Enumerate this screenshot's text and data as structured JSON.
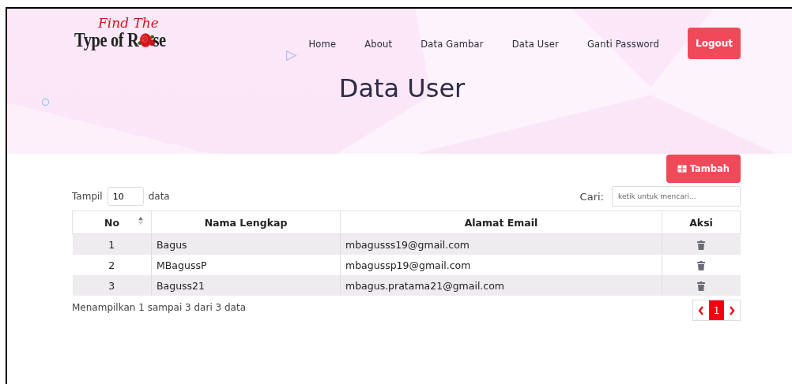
{
  "nav": {
    "logo": {
      "script": "Find The",
      "main_left": "Type of R",
      "main_right": "se"
    },
    "links": [
      "Home",
      "About",
      "Data Gambar",
      "Data User",
      "Ganti Password"
    ],
    "logout": "Logout"
  },
  "page_title": "Data User",
  "add_button": "Tambah",
  "length": {
    "label_before": "Tampil",
    "value": "10",
    "label_after": "data"
  },
  "search": {
    "label": "Cari:",
    "placeholder": "ketik untuk mencari..."
  },
  "table": {
    "columns": [
      {
        "label": "No",
        "kind": "text",
        "sorted": true
      },
      {
        "label": "Nama Lengkap",
        "kind": "text",
        "sorted": false
      },
      {
        "label": "Alamat Email",
        "kind": "text",
        "sorted": false
      },
      {
        "label": "Aksi",
        "kind": "action",
        "sorted": false
      }
    ],
    "rows": [
      {
        "cells": [
          "1",
          "Bagus",
          "mbagusss19@gmail.com"
        ]
      },
      {
        "cells": [
          "2",
          "MBagussP",
          "mbagussp19@gmail.com"
        ]
      },
      {
        "cells": [
          "3",
          "Baguss21",
          "mbagus.pratama21@gmail.com"
        ]
      }
    ]
  },
  "info": "Menampilkan 1 sampai 3 dari 3 data",
  "pagination": {
    "pages": [
      {
        "label": "1",
        "selected": true
      }
    ]
  }
}
